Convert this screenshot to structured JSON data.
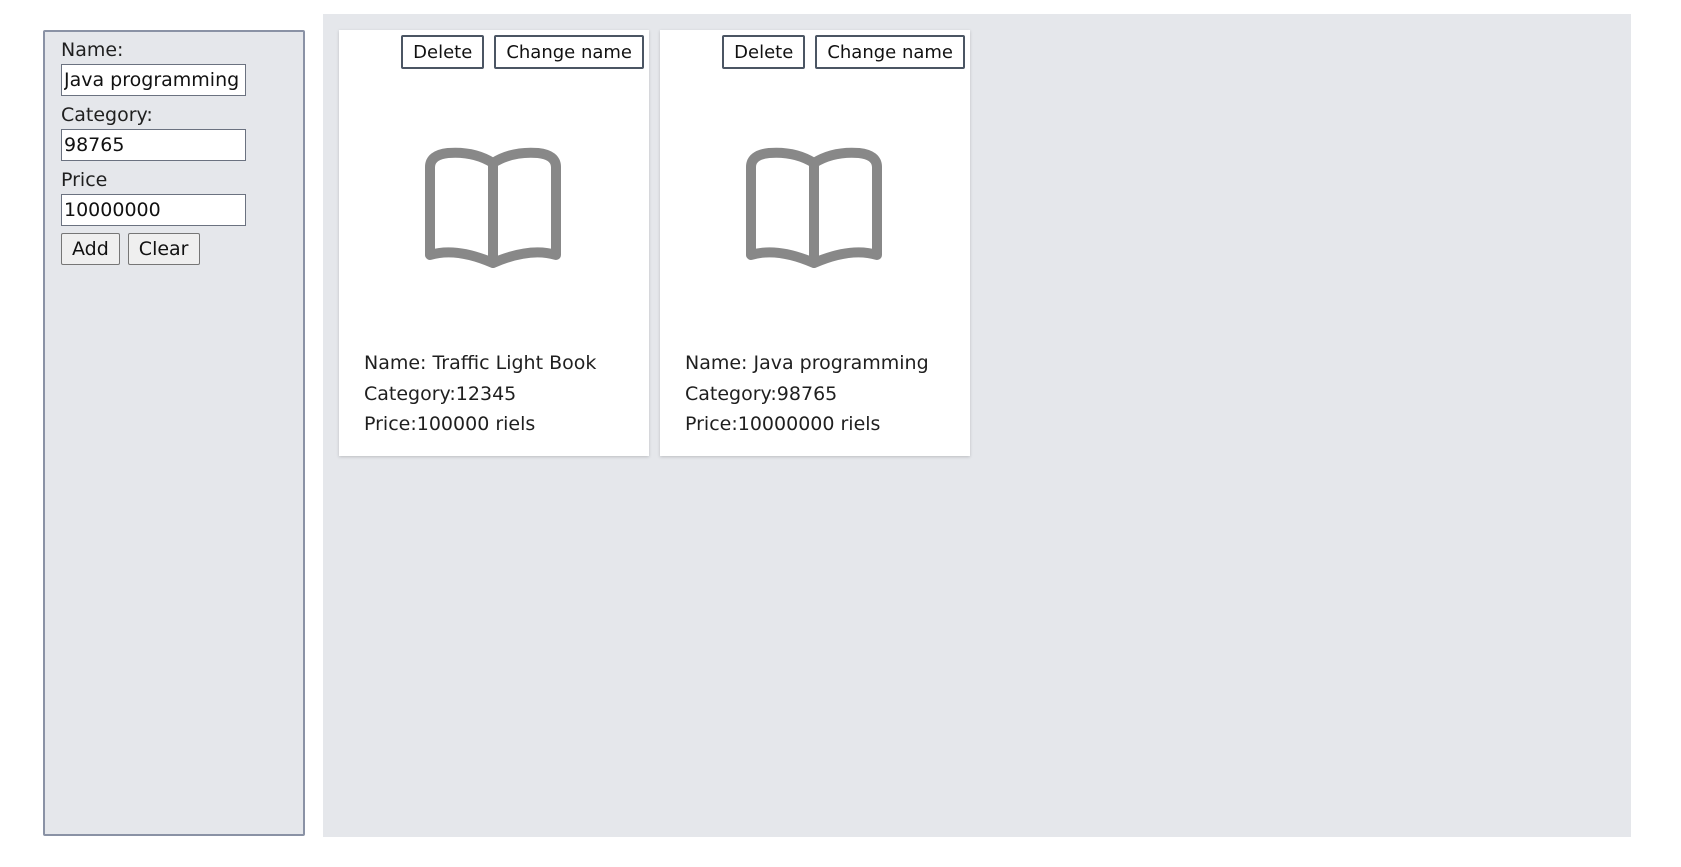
{
  "form": {
    "name_label": "Name:",
    "name_value": "Java programming",
    "category_label": "Category:",
    "category_value": "98765",
    "price_label": "Price",
    "price_value": "10000000",
    "add_label": "Add",
    "clear_label": "Clear"
  },
  "cards": [
    {
      "delete_label": "Delete",
      "change_name_label": "Change name",
      "icon": "open-book-icon",
      "name_text": "Name: Traffic Light Book",
      "category_text": "Category:12345",
      "price_text": "Price:100000 riels"
    },
    {
      "delete_label": "Delete",
      "change_name_label": "Change name",
      "icon": "open-book-icon",
      "name_text": "Name: Java programming",
      "category_text": "Category:98765",
      "price_text": "Price:10000000 riels"
    }
  ],
  "colors": {
    "panel_background": "#e5e7eb",
    "panel_border": "#8a92a5",
    "icon_gray": "#888888",
    "card_background": "#ffffff"
  }
}
